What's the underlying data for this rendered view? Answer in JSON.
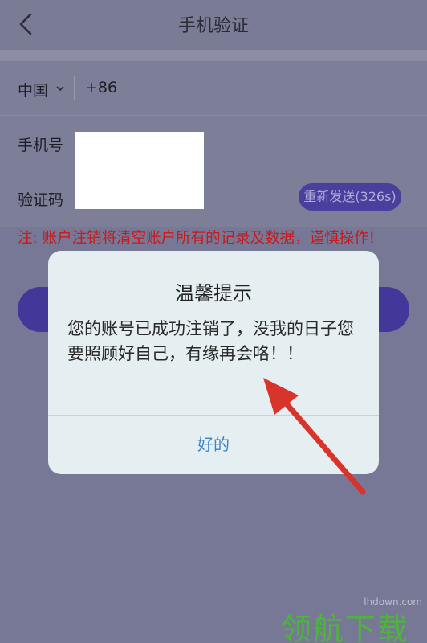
{
  "header": {
    "title": "手机验证"
  },
  "form": {
    "country": "中国",
    "dial_code": "+86",
    "phone_label": "手机号",
    "code_label": "验证码",
    "resend_label": "重新发送(326s)"
  },
  "warning": "注: 账户注销将清空账户所有的记录及数据，谨慎操作!",
  "dialog": {
    "title": "温馨提示",
    "message": "您的账号已成功注销了，没我的日子您要照顾好自己，有缘再会咯！！",
    "ok_label": "好的"
  },
  "watermark": {
    "url": "lhdown.com",
    "logo": "领航下载"
  },
  "colors": {
    "accent": "#43389a",
    "warning": "#c8191c",
    "link": "#3d84c6",
    "annotation_arrow": "#d9342b"
  }
}
